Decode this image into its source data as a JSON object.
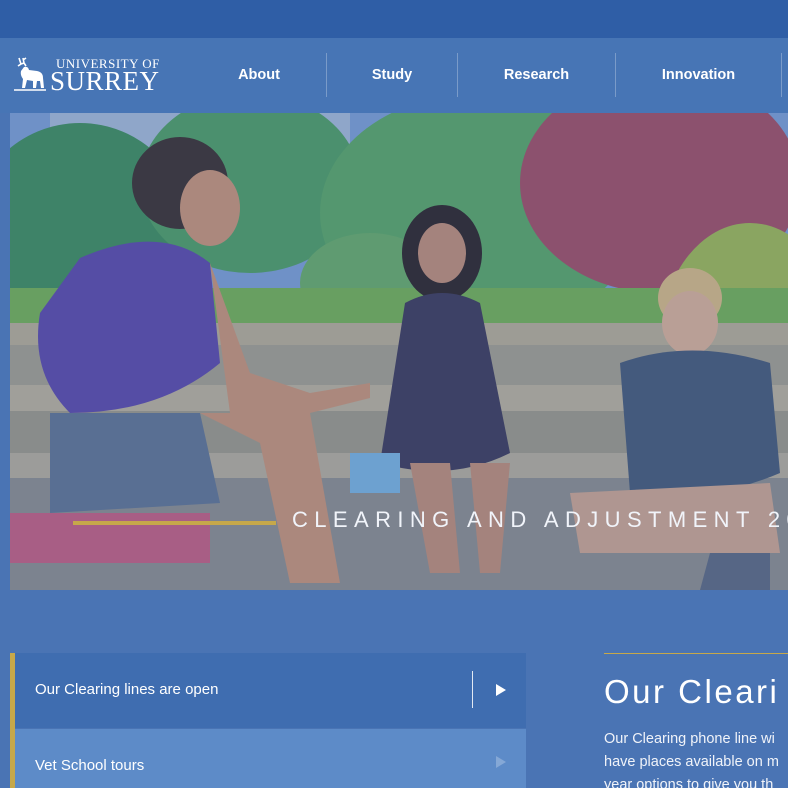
{
  "brand": {
    "line1": "UNIVERSITY OF",
    "line2": "SURREY",
    "icon": "stag-icon"
  },
  "nav": {
    "items": [
      {
        "label": "About"
      },
      {
        "label": "Study"
      },
      {
        "label": "Research"
      },
      {
        "label": "Innovation"
      }
    ]
  },
  "hero": {
    "title": "CLEARING AND ADJUSTMENT 20"
  },
  "quicklinks": [
    {
      "label": "Our Clearing lines are open",
      "icon": "play-arrow-icon"
    },
    {
      "label": "Vet School tours",
      "icon": "play-arrow-icon"
    }
  ],
  "article": {
    "title": "Our Cleari",
    "lines": [
      "Our Clearing phone line wi",
      "have places available on m",
      "year options to give you th"
    ]
  },
  "colors": {
    "nav_bg": "#4775b5",
    "accent_gold": "#c6a84a",
    "row_primary": "#3f6db0",
    "row_secondary": "#5d8bc8"
  }
}
